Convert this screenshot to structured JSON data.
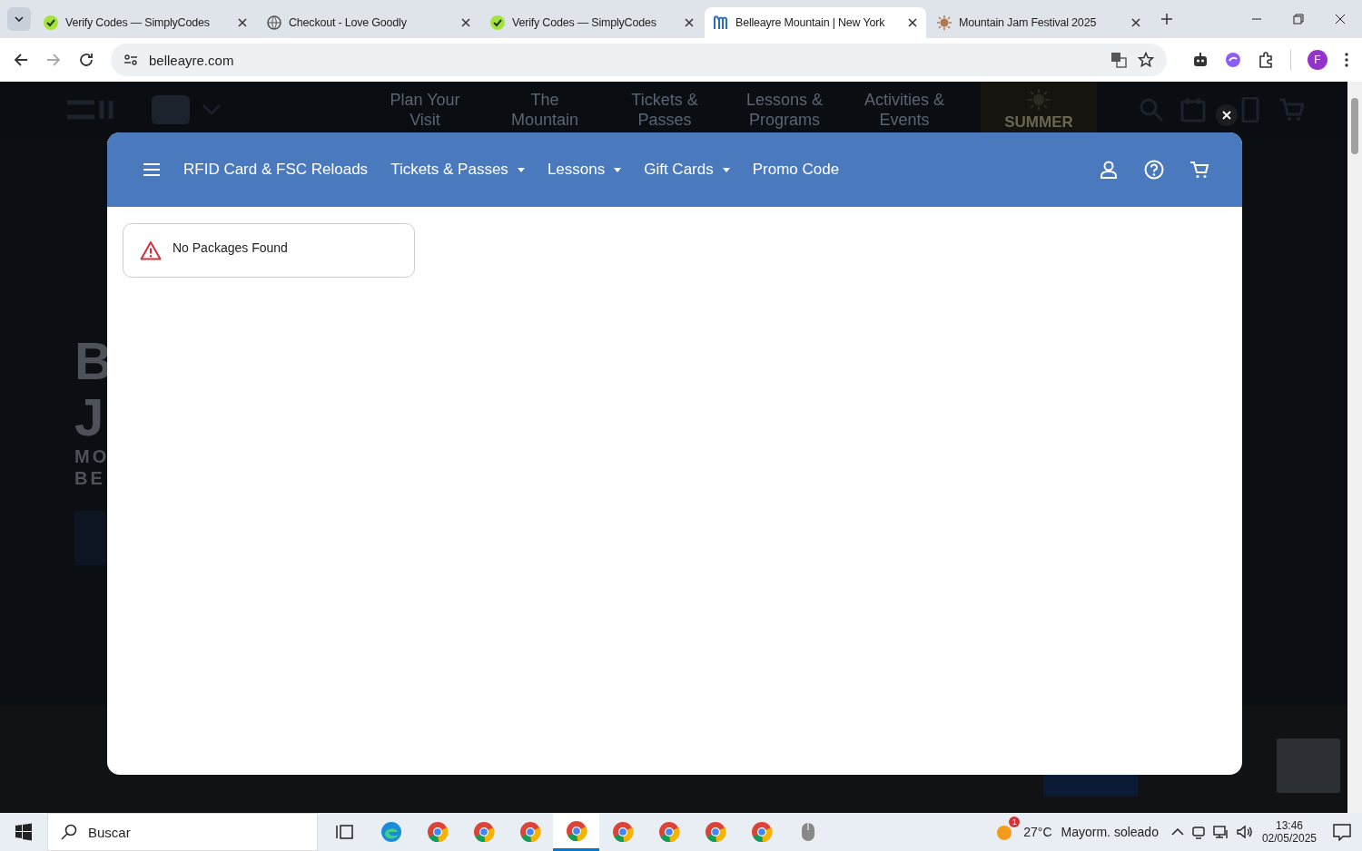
{
  "browser": {
    "tabs": [
      {
        "title": "Verify Codes — SimplyCodes",
        "kind": "check",
        "selected": false
      },
      {
        "title": "Checkout - Love Goodly",
        "kind": "globe",
        "selected": false
      },
      {
        "title": "Verify Codes — SimplyCodes",
        "kind": "check",
        "selected": false
      },
      {
        "title": "Belleayre Mountain | New York",
        "kind": "m",
        "selected": true
      },
      {
        "title": "Mountain Jam Festival 2025",
        "kind": "sun",
        "selected": false
      }
    ],
    "address": "belleayre.com",
    "profile": "F"
  },
  "site": {
    "nav": [
      "Plan Your\nVisit",
      "The\nMountain",
      "Tickets &\nPasses",
      "Lessons &\nPrograms",
      "Activities &\nEvents"
    ],
    "season": "SUMMER",
    "hero": [
      "B",
      "J"
    ],
    "hero_sub": [
      "MO",
      "BE"
    ]
  },
  "modal": {
    "menu": [
      {
        "label": "RFID Card & FSC Reloads",
        "dropdown": false
      },
      {
        "label": "Tickets & Passes",
        "dropdown": true
      },
      {
        "label": "Lessons",
        "dropdown": true
      },
      {
        "label": "Gift Cards",
        "dropdown": true
      },
      {
        "label": "Promo Code",
        "dropdown": false
      }
    ],
    "message": "No Packages Found"
  },
  "taskbar": {
    "search": "Buscar",
    "apps": [
      {
        "kind": "taskview",
        "selected": false
      },
      {
        "kind": "edge",
        "selected": false
      },
      {
        "kind": "chrome",
        "selected": false
      },
      {
        "kind": "chrome",
        "selected": false
      },
      {
        "kind": "chrome",
        "selected": false
      },
      {
        "kind": "chrome",
        "selected": true
      },
      {
        "kind": "chrome",
        "selected": false
      },
      {
        "kind": "chrome",
        "selected": false
      },
      {
        "kind": "chrome",
        "selected": false
      },
      {
        "kind": "chrome",
        "selected": false
      },
      {
        "kind": "mouse",
        "selected": false
      }
    ],
    "weather": "27°C",
    "forecast": "Mayorm. soleado",
    "weather_badge": "1",
    "time": "13:46",
    "date": "02/05/2025"
  }
}
